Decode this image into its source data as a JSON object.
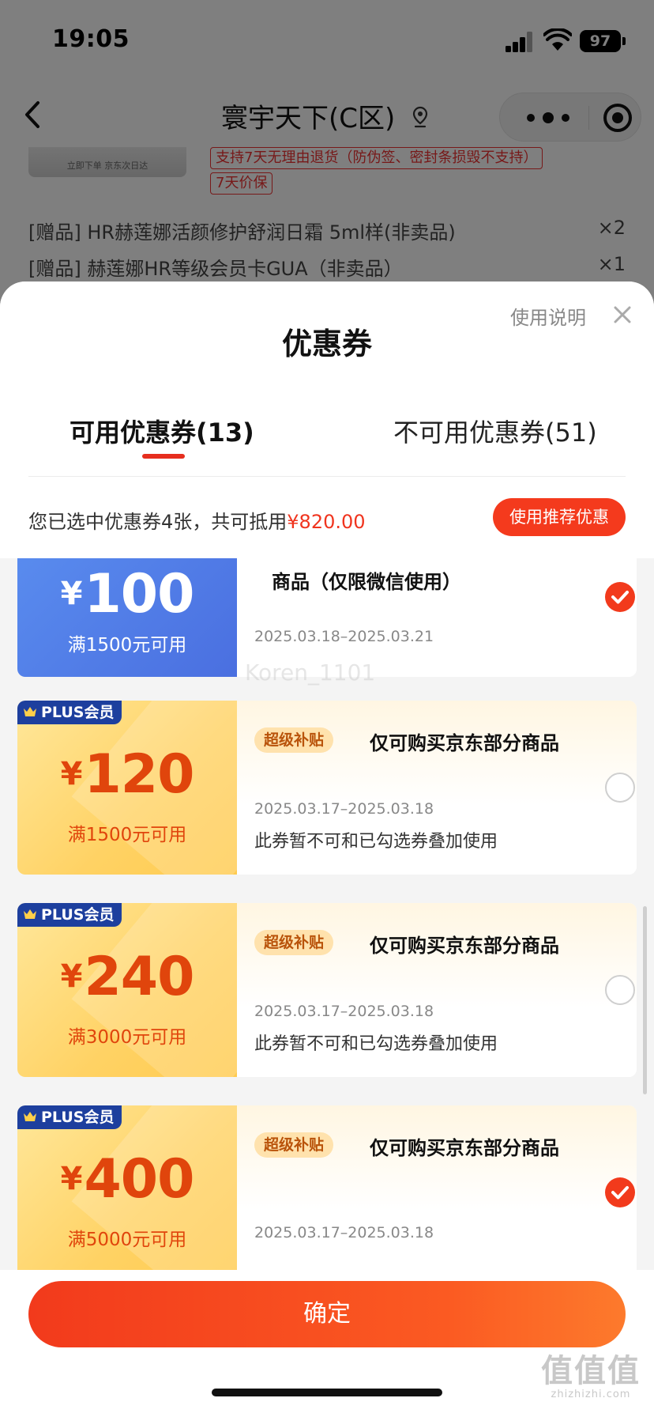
{
  "status_bar": {
    "time": "19:05",
    "battery": "97"
  },
  "nav": {
    "title": "寰宇天下(C区)"
  },
  "background_page": {
    "thumb_text": "立即下单 京东次日达",
    "return_policy_tag": "支持7天无理由退货（防伪签、密封条损毁不支持）",
    "price_protect_tag": "7天价保",
    "gifts": [
      {
        "label": "[赠品] HR赫莲娜活颜修护舒润日霜 5ml样(非卖品)",
        "qty": "×2"
      },
      {
        "label": "[赠品] 赫莲娜HR等级会员卡GUA（非卖品）",
        "qty": "×1"
      }
    ]
  },
  "sheet": {
    "usage_link": "使用说明",
    "title": "优惠券",
    "tabs": [
      {
        "label": "可用优惠券(13)"
      },
      {
        "label": "不可用优惠券(51)"
      }
    ],
    "summary_prefix": "您已选中优惠券4张，共可抵用",
    "summary_amount": "¥820.00",
    "recommend_button": "使用推荐优惠"
  },
  "coupons": [
    {
      "currency": "¥",
      "amount": "100",
      "threshold": "满1500元可用",
      "title": "商品（仅限微信使用）",
      "date": "2025.03.18–2025.03.21",
      "selected": true
    },
    {
      "badge": "PLUS会员",
      "currency": "¥",
      "amount": "120",
      "threshold": "满1500元可用",
      "tag": "超级补贴",
      "title": "仅可购买京东部分商品",
      "date": "2025.03.17–2025.03.18",
      "note": "此券暂不可和已勾选券叠加使用",
      "selected": false
    },
    {
      "badge": "PLUS会员",
      "currency": "¥",
      "amount": "240",
      "threshold": "满3000元可用",
      "tag": "超级补贴",
      "title": "仅可购买京东部分商品",
      "date": "2025.03.17–2025.03.18",
      "note": "此券暂不可和已勾选券叠加使用",
      "selected": false
    },
    {
      "badge": "PLUS会员",
      "currency": "¥",
      "amount": "400",
      "threshold": "满5000元可用",
      "tag": "超级补贴",
      "title": "仅可购买京东部分商品",
      "date": "2025.03.17–2025.03.18",
      "selected": true
    }
  ],
  "watermark": "Koren_1101",
  "footer": {
    "confirm_button": "确定"
  },
  "site_mark": {
    "logo": "值值值",
    "url": "zhizhizhi.com"
  },
  "colors": {
    "accent": "#f23a1c",
    "plus_badge": "#1d3f9e",
    "gold": "#ffd264"
  }
}
